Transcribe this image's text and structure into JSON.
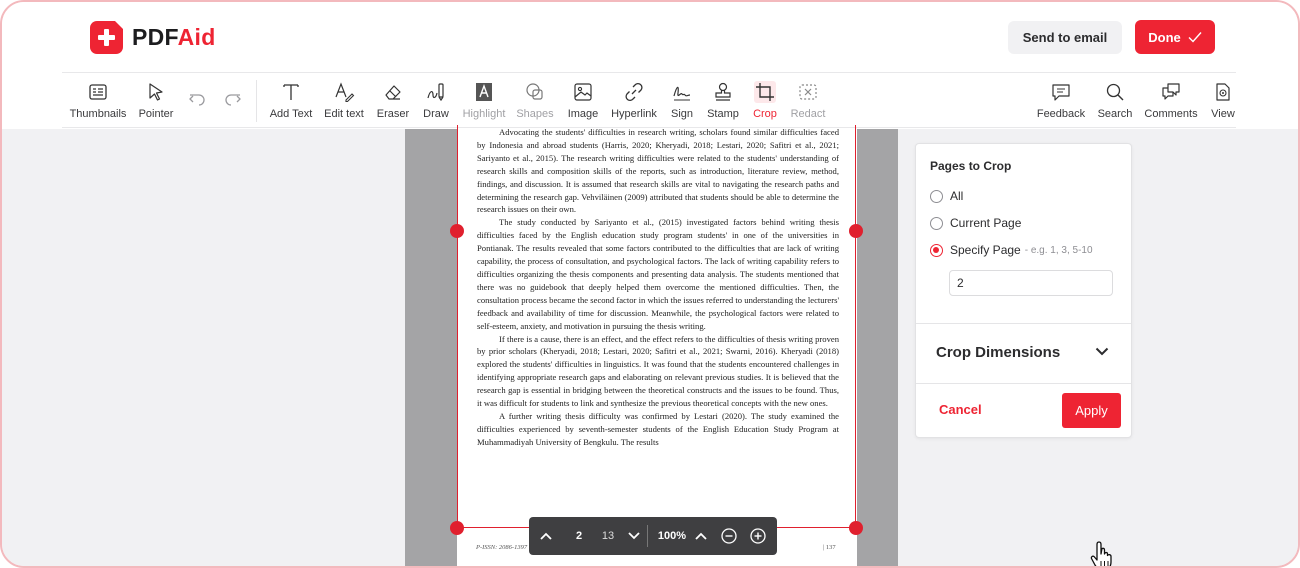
{
  "brand": {
    "name_prefix": "PDF",
    "name_suffix": "Aid",
    "accent": "#ee2433"
  },
  "header": {
    "send_label": "Send to email",
    "done_label": "Done"
  },
  "toolbar": {
    "left": [
      {
        "label": "Thumbnails",
        "icon": "thumbnails-icon"
      },
      {
        "label": "Pointer",
        "icon": "pointer-icon"
      }
    ],
    "undo_icon": "undo-icon",
    "redo_icon": "redo-icon",
    "tools": [
      {
        "label": "Add Text",
        "icon": "text-icon"
      },
      {
        "label": "Edit text",
        "icon": "edit-text-icon"
      },
      {
        "label": "Eraser",
        "icon": "eraser-icon"
      },
      {
        "label": "Draw",
        "icon": "draw-icon"
      },
      {
        "label": "Highlight",
        "icon": "highlight-icon"
      },
      {
        "label": "Shapes",
        "icon": "shapes-icon"
      },
      {
        "label": "Image",
        "icon": "image-icon"
      },
      {
        "label": "Hyperlink",
        "icon": "link-icon"
      },
      {
        "label": "Sign",
        "icon": "sign-icon"
      },
      {
        "label": "Stamp",
        "icon": "stamp-icon"
      },
      {
        "label": "Crop",
        "icon": "crop-icon"
      },
      {
        "label": "Redact",
        "icon": "redact-icon"
      }
    ],
    "right": [
      {
        "label": "Feedback",
        "icon": "feedback-icon"
      },
      {
        "label": "Search",
        "icon": "search-icon"
      },
      {
        "label": "Comments",
        "icon": "comments-icon"
      },
      {
        "label": "View",
        "icon": "view-icon"
      }
    ]
  },
  "document": {
    "paragraphs": [
      "Advocating the students' difficulties in research writing, scholars found similar difficulties faced by Indonesia and abroad students (Harris, 2020; Kheryadi, 2018; Lestari, 2020; Safitri et al., 2021; Sariyanto et al., 2015). The research writing difficulties were related to the students' understanding of research skills and composition skills of the reports, such as introduction, literature review, method, findings, and discussion. It is assumed that research skills are vital to navigating the research paths and determining the research gap. Vehviläinen (2009) attributed that students should be able to determine the research issues on their own.",
      "The study conducted by Sariyanto et al., (2015) investigated factors behind writing thesis difficulties faced by the English education study program students' in one of the universities in Pontianak. The results revealed that some factors contributed to the difficulties that are lack of writing capability, the process of consultation, and psychological factors. The lack of writing capability refers to difficulties organizing the thesis components and presenting data analysis. The students mentioned that there was no guidebook that deeply helped them overcome the mentioned difficulties. Then, the consultation process became the second factor in which the issues referred to understanding the lecturers' feedback and availability of time for discussion. Meanwhile, the psychological factors were related to self-esteem, anxiety, and motivation in pursuing the thesis writing.",
      "If there is a cause, there is an effect, and the effect refers to the difficulties of thesis writing proven by prior scholars (Kheryadi, 2018; Lestari, 2020; Safitri et al., 2021; Swarni, 2016). Kheryadi (2018) explored the students' difficulties in linguistics. It was found that the students encountered challenges in identifying appropriate research gaps and elaborating on relevant previous studies. It is believed that the research gap is essential in bridging between the theoretical constructs and the issues to be found. Thus, it was difficult for students to link and synthesize the previous theoretical concepts with the new ones.",
      "A further writing thesis difficulty was confirmed by Lestari (2020). The study examined the difficulties experienced by seventh-semester students of the English Education Study Program at Muhammadiyah University of Bengkulu. The results"
    ],
    "footer_left": "P-ISSN: 2086-1397 | E-ISSN: 2502-6380",
    "footer_right": "| 137"
  },
  "pager": {
    "current_page": "2",
    "total_pages": "13",
    "zoom": "100%"
  },
  "crop_panel": {
    "title": "Pages to Crop",
    "options": [
      {
        "label": "All",
        "selected": false
      },
      {
        "label": "Current Page",
        "selected": false
      },
      {
        "label": "Specify Page",
        "selected": true,
        "hint": "- e.g. 1, 3, 5-10"
      }
    ],
    "specify_value": "2",
    "dimensions_label": "Crop Dimensions",
    "cancel_label": "Cancel",
    "apply_label": "Apply"
  }
}
